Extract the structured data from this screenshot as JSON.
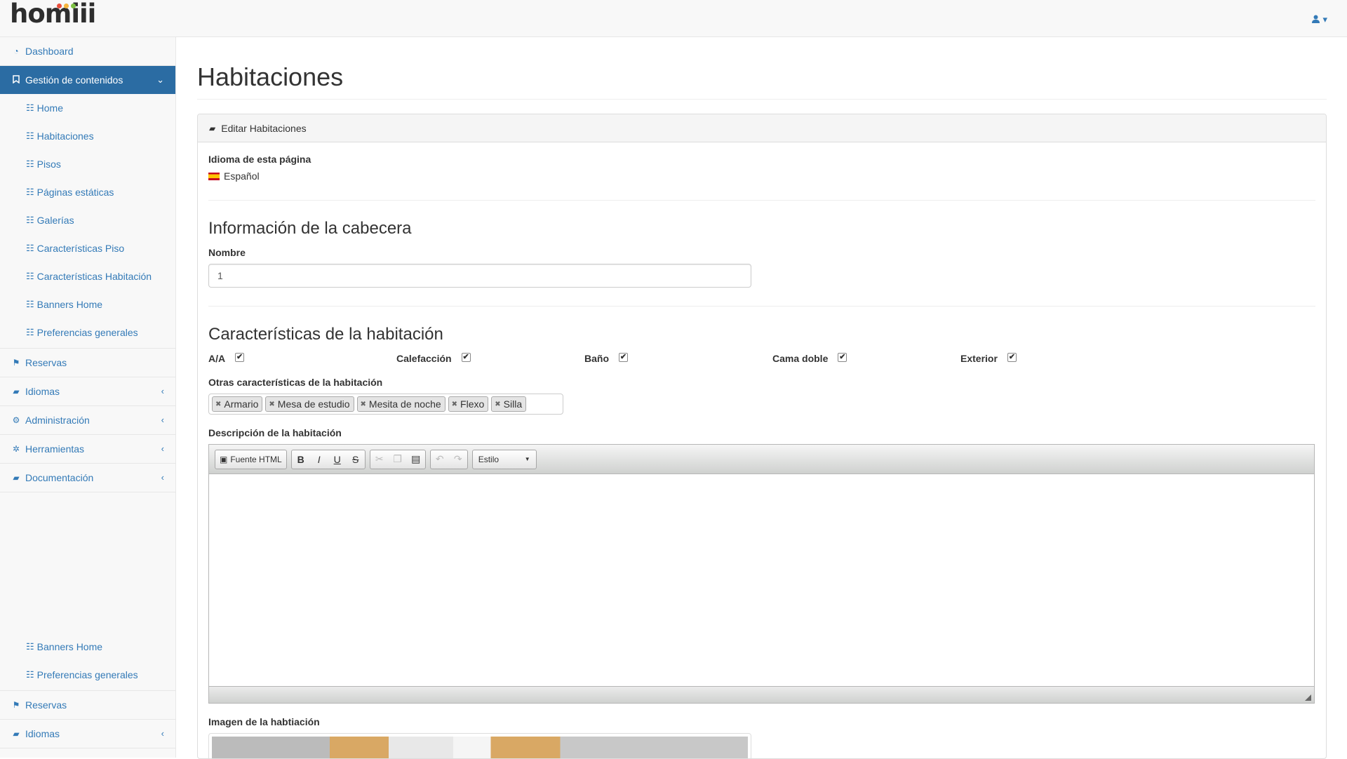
{
  "brand": {
    "logo_text": "homiii",
    "dot_colors": [
      "#e94e3c",
      "#f5b43c",
      "#7dc242"
    ]
  },
  "topbar": {
    "user_icon": "user-icon",
    "caret": "▾"
  },
  "sidebar": {
    "top_items": [
      {
        "label": "Dashboard",
        "icon": "dashboard-icon"
      },
      {
        "label": "Gestión de contenidos",
        "icon": "bookmark-icon",
        "active": true,
        "chevron": "down"
      }
    ],
    "sub_items": [
      {
        "label": "Home"
      },
      {
        "label": "Habitaciones"
      },
      {
        "label": "Pisos"
      },
      {
        "label": "Páginas estáticas"
      },
      {
        "label": "Galerías"
      },
      {
        "label": "Características Piso"
      },
      {
        "label": "Características Habitación"
      },
      {
        "label": "Banners Home"
      },
      {
        "label": "Preferencias generales"
      }
    ],
    "bottom_items": [
      {
        "label": "Reservas",
        "icon": "flag-icon"
      },
      {
        "label": "Idiomas",
        "icon": "book-icon",
        "chevron": "left"
      },
      {
        "label": "Administración",
        "icon": "cogs-icon",
        "chevron": "left"
      },
      {
        "label": "Herramientas",
        "icon": "gear-icon",
        "chevron": "left"
      },
      {
        "label": "Documentación",
        "icon": "book-icon",
        "chevron": "left"
      }
    ],
    "dup_sub_items": [
      {
        "label": "Banners Home"
      },
      {
        "label": "Preferencias generales"
      }
    ],
    "dup_bottom_items": [
      {
        "label": "Reservas",
        "icon": "flag-icon"
      },
      {
        "label": "Idiomas",
        "icon": "book-icon",
        "chevron": "left"
      }
    ]
  },
  "page": {
    "title": "Habitaciones",
    "panel_heading": "Editar Habitaciones",
    "language_label": "Idioma de esta página",
    "language_value": "Español",
    "header_section_title": "Información de la cabecera",
    "name_label": "Nombre",
    "name_value": "1",
    "features_section_title": "Características de la habitación",
    "checkboxes": [
      {
        "label": "A/A",
        "checked": true
      },
      {
        "label": "Calefacción",
        "checked": true
      },
      {
        "label": "Baño",
        "checked": true
      },
      {
        "label": "Cama doble",
        "checked": true
      },
      {
        "label": "Exterior",
        "checked": true
      }
    ],
    "other_features_label": "Otras características de la habitación",
    "tags": [
      "Armario",
      "Mesa de estudio",
      "Mesita de noche",
      "Flexo",
      "Silla"
    ],
    "description_label": "Descripción de la habitación",
    "editor": {
      "source_label": "Fuente HTML",
      "style_label": "Estilo",
      "buttons": [
        "B",
        "I",
        "U",
        "S"
      ]
    },
    "image_label": "Imagen de la habtiación"
  }
}
